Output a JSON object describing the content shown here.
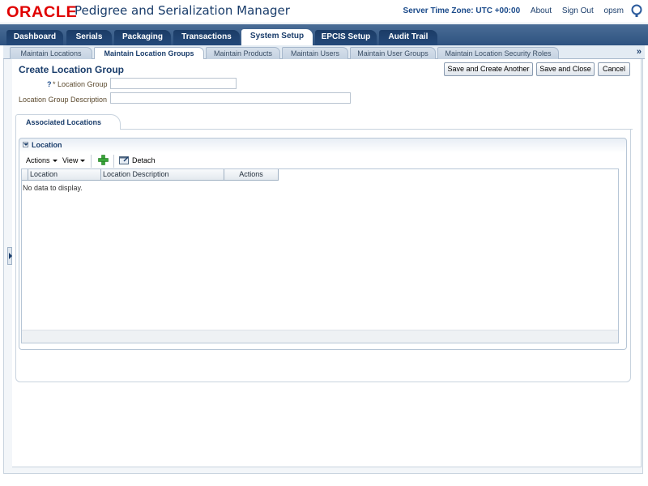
{
  "header": {
    "logo_text": "ORACLE",
    "app_title": "Pedigree and Serialization Manager",
    "server_time_zone": "Server Time Zone: UTC +00:00",
    "links": [
      "About",
      "Sign Out",
      "opsm"
    ]
  },
  "main_tabs": [
    "Dashboard",
    "Serials",
    "Packaging",
    "Transactions",
    "System Setup",
    "EPCIS Setup",
    "Audit Trail"
  ],
  "main_tab_selected": "System Setup",
  "sub_tabs": [
    "Maintain Locations",
    "Maintain Location Groups",
    "Maintain Products",
    "Maintain Users",
    "Maintain User Groups",
    "Maintain Location Security Roles"
  ],
  "sub_tab_selected": "Maintain Location Groups",
  "overflow_label": "»",
  "page": {
    "title": "Create Location Group",
    "buttons": {
      "save_create_another": "Save and Create Another",
      "save_close": "Save and Close",
      "cancel": "Cancel"
    },
    "help_marker": "?",
    "fields": {
      "location_group_label": "* Location Group",
      "location_group_value": "",
      "description_label": "Location Group Description",
      "description_value": ""
    }
  },
  "associated": {
    "tab_label": "Associated Locations",
    "section_title": "Location",
    "toolbar": {
      "actions": "Actions",
      "view": "View",
      "detach": "Detach"
    },
    "table": {
      "columns": [
        "Location",
        "Location Description",
        "Actions"
      ],
      "empty_text": "No data to display."
    }
  },
  "colors": {
    "brand_red": "#e00000",
    "nav_blue": "#2e5280",
    "title_blue": "#1a3d6b",
    "add_green": "#3aa53a"
  },
  "icons": [
    "help-icon",
    "add-icon",
    "detach-icon",
    "disclose-icon",
    "splitter-icon"
  ]
}
